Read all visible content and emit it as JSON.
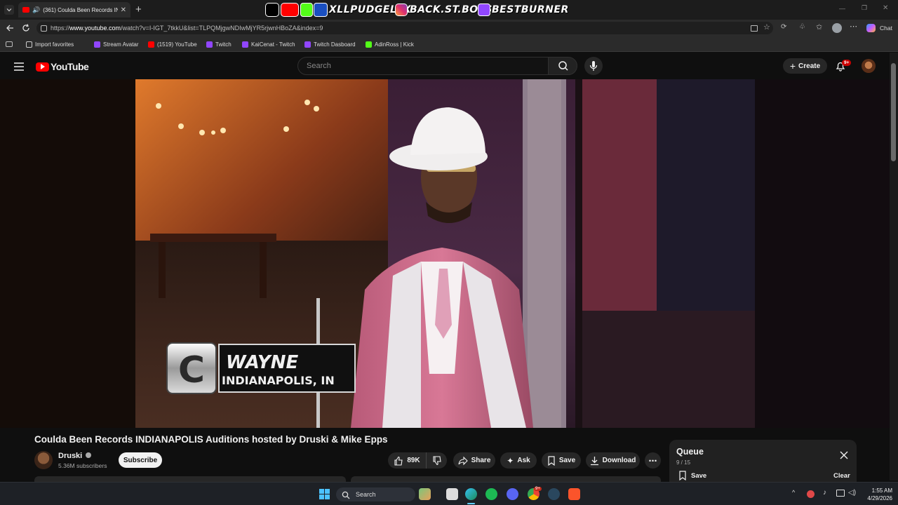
{
  "browser": {
    "tab_title": "(361) Coulda Been Records IN",
    "new_tab": "+",
    "url_prefix": "https://",
    "url_host": "www.youtube.com",
    "url_rest": "/watch?v=I-IGT_7tkkU&list=TLPQMjgwNDIwMjYR5rjwnHBoZA&index=9",
    "chat_label": "Chat",
    "banner": [
      "XLLPUDGELLX",
      "BACK.ST.BOYS",
      "BESTBURNER"
    ],
    "bookmarks": [
      "Import favorites",
      "Stream Avatar",
      "(1519) YouTube",
      "Twitch",
      "KaiCenat - Twitch",
      "Twitch Dasboard",
      "AdinRoss | Kick"
    ]
  },
  "youtube": {
    "logo": "YouTube",
    "search_placeholder": "Search",
    "create_label": "Create",
    "notif_badge": "9+"
  },
  "video": {
    "lower_third_letter": "C",
    "lower_third_name": "WAYNE",
    "lower_third_city": "INDIANAPOLIS, IN"
  },
  "meta": {
    "title": "Coulda Been Records INDIANAPOLIS Auditions hosted by Druski & Mike Epps",
    "channel": "Druski",
    "subscribers": "5.36M subscribers",
    "subscribe": "Subscribe",
    "likes": "89K",
    "share": "Share",
    "ask": "Ask",
    "save": "Save",
    "download": "Download"
  },
  "queue": {
    "title": "Queue",
    "position": "9 / 15",
    "save": "Save",
    "clear": "Clear"
  },
  "taskbar": {
    "search": "Search",
    "time": "1:55 AM",
    "date": "4/29/2026",
    "badge": "9+"
  }
}
